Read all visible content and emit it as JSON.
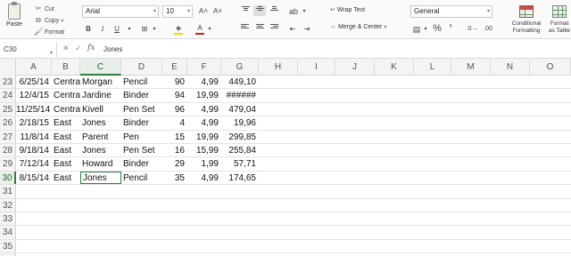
{
  "ribbon": {
    "paste_label": "Paste",
    "cut_label": "Cut",
    "copy_label": "Copy",
    "format_label": "Format",
    "font_name": "Arial",
    "font_size": "10",
    "grow_font": "A˄",
    "shrink_font": "A˅",
    "bold": "B",
    "italic": "I",
    "underline": "U",
    "wrap_text_label": "Wrap Text",
    "merge_center_label": "Merge & Center",
    "number_format": "General",
    "percent": "%",
    "comma": "’",
    "conditional_formatting_line1": "Conditional",
    "conditional_formatting_line2": "Formatting",
    "format_table_line1": "Format",
    "format_table_line2": "as Table",
    "fill_color": "#f5d000",
    "font_color": "#d11c1c"
  },
  "formula_bar": {
    "name_box": "C30",
    "fx": "fx",
    "value": "Jones"
  },
  "grid": {
    "active_column": "C",
    "active_row": "30",
    "columns": [
      "A",
      "B",
      "C",
      "D",
      "E",
      "F",
      "G",
      "H",
      "I",
      "J",
      "K",
      "L",
      "M",
      "N",
      "O"
    ],
    "rows": [
      {
        "num": "23",
        "cells": [
          "6/25/14",
          "Central",
          "Morgan",
          "Pencil",
          "90",
          "4,99",
          "449,10"
        ]
      },
      {
        "num": "24",
        "cells": [
          "12/4/15",
          "Central",
          "Jardine",
          "Binder",
          "94",
          "19,99",
          "######"
        ]
      },
      {
        "num": "25",
        "cells": [
          "11/25/14",
          "Central",
          "Kivell",
          "Pen Set",
          "96",
          "4,99",
          "479,04"
        ]
      },
      {
        "num": "26",
        "cells": [
          "2/18/15",
          "East",
          "Jones",
          "Binder",
          "4",
          "4,99",
          "19,96"
        ]
      },
      {
        "num": "27",
        "cells": [
          "11/8/14",
          "East",
          "Parent",
          "Pen",
          "15",
          "19,99",
          "299,85"
        ]
      },
      {
        "num": "28",
        "cells": [
          "9/18/14",
          "East",
          "Jones",
          "Pen Set",
          "16",
          "15,99",
          "255,84"
        ]
      },
      {
        "num": "29",
        "cells": [
          "7/12/14",
          "East",
          "Howard",
          "Binder",
          "29",
          "1,99",
          "57,71"
        ]
      },
      {
        "num": "30",
        "cells": [
          "8/15/14",
          "East",
          "Jones",
          "Pencil",
          "35",
          "4,99",
          "174,65"
        ]
      },
      {
        "num": "31",
        "cells": [
          "",
          "",
          "",
          "",
          "",
          "",
          ""
        ]
      },
      {
        "num": "32",
        "cells": [
          "",
          "",
          "",
          "",
          "",
          "",
          ""
        ]
      },
      {
        "num": "33",
        "cells": [
          "",
          "",
          "",
          "",
          "",
          "",
          ""
        ]
      },
      {
        "num": "34",
        "cells": [
          "",
          "",
          "",
          "",
          "",
          "",
          ""
        ]
      },
      {
        "num": "35",
        "cells": [
          "",
          "",
          "",
          "",
          "",
          "",
          ""
        ]
      },
      {
        "num": "36",
        "cells": [
          "",
          "",
          "",
          "",
          "",
          "",
          ""
        ]
      }
    ]
  }
}
